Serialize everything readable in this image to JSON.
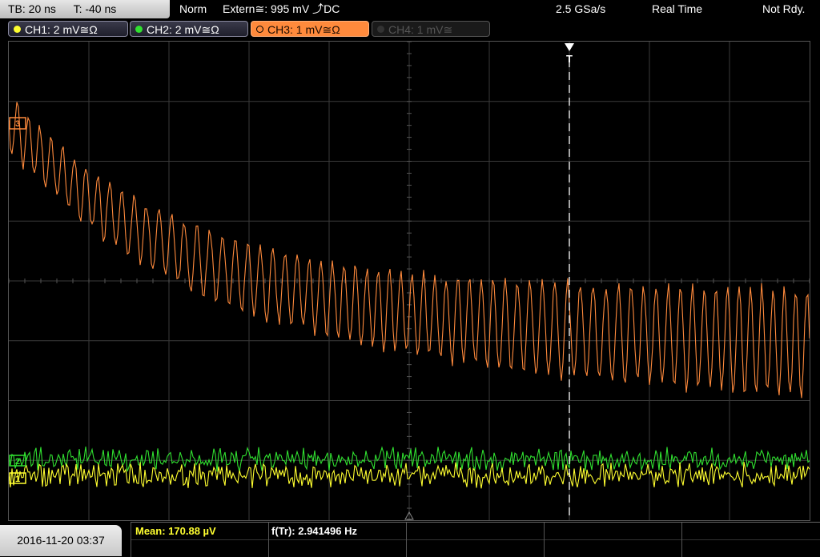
{
  "header": {
    "timebase": "TB: 20 ns",
    "trigger_time": "T: -40 ns",
    "trigger_mode": "Norm",
    "trigger_source": "Extern≅: 995 mV ⤴DC",
    "sample_rate": "2.5 GSa/s",
    "acq_mode": "Real Time",
    "status": "Not Rdy."
  },
  "channels": [
    {
      "label": "CH1: 2 mV≅Ω",
      "color": "#ffff30",
      "state": "on"
    },
    {
      "label": "CH2: 2 mV≅Ω",
      "color": "#30e030",
      "state": "on"
    },
    {
      "label": "CH3: 1 mV≅Ω",
      "color": "#ff8a3c",
      "state": "selected"
    },
    {
      "label": "CH4: 1 mV≅",
      "color": "#555555",
      "state": "off"
    }
  ],
  "markers": {
    "ch3": "3",
    "ch2": "2",
    "ch1": "1",
    "trigger": "T"
  },
  "footer": {
    "datetime": "2016-11-20 03:37",
    "mean": "Mean: 170.88 µV",
    "freq_label": "f(Tr):",
    "freq_value": "2.941496 Hz"
  },
  "colors": {
    "ch1": "#ffff30",
    "ch2": "#30e030",
    "ch3": "#ff8a3c",
    "grid": "#3a3a3a",
    "mean_text": "#ffff30"
  }
}
